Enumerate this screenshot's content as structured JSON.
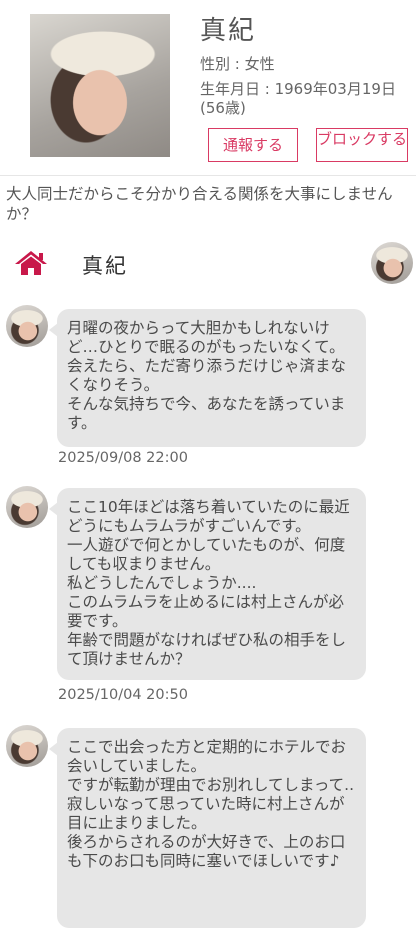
{
  "profile": {
    "name": "真紀",
    "gender": "性別 : 女性",
    "birth": "生年月日 : 1969年03月19日(56歳)",
    "report_label": "通報する",
    "block_label": "ブロックする"
  },
  "bio": "大人同士だからこそ分かり合える関係を大事にしませんか？",
  "chat": {
    "name": "真紀",
    "messages": [
      {
        "text": "月曜の夜からって大胆かもしれないけど…ひとりで眠るのがもったいなくて。\n会えたら、ただ寄り添うだけじゃ済まなくなりそう。\nそんな気持ちで今、あなたを誘っています。",
        "time": "2025/09/08 22:00"
      },
      {
        "text": "ここ10年ほどは落ち着いていたのに最近どうにもムラムラがすごいんです。\n一人遊びで何とかしていたものが、何度しても収まりません。\n私どうしたんでしょうか....\nこのムラムラを止めるには村上さんが必要です。\n年齢で問題がなければぜひ私の相手をして頂けませんか？",
        "time": "2025/10/04 20:50"
      },
      {
        "text": "ここで出会った方と定期的にホテルでお会いしていました。\nですが転勤が理由でお別れしてしまって..\n寂しいなって思っていた時に村上さんが目に止まりました。\n後ろからされるのが大好きで、上のお口も下のお口も同時に塞いでほしいです♪",
        "time": ""
      }
    ]
  },
  "colors": {
    "accent": "#d93a63",
    "bubble": "#e6e6e6"
  },
  "icons": {
    "home": "home-icon"
  }
}
